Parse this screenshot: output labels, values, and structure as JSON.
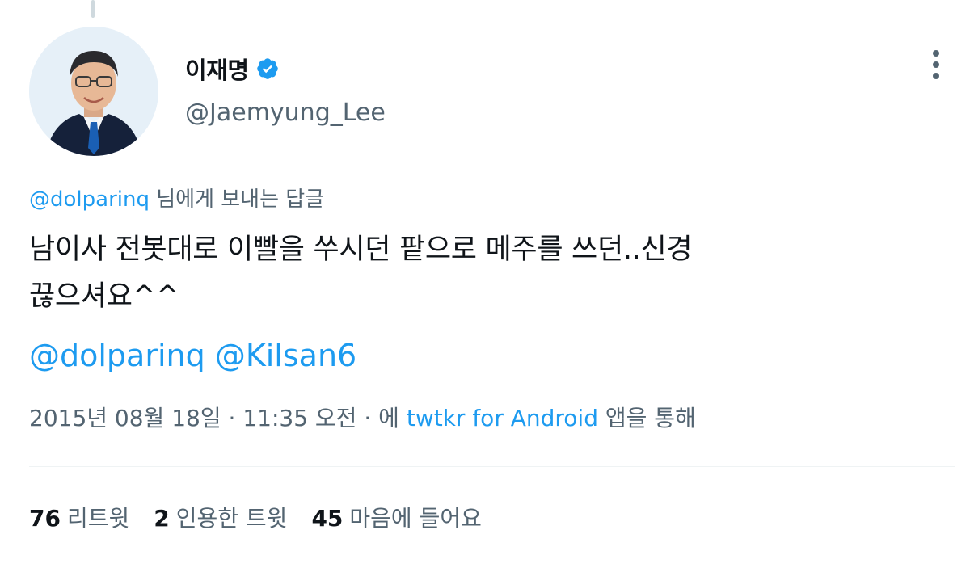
{
  "author": {
    "display_name": "이재명",
    "handle": "@Jaemyung_Lee",
    "verified": true
  },
  "reply_to": {
    "handle": "@dolparinq",
    "suffix": "님에게 보내는 답글"
  },
  "tweet": {
    "line1": "남이사 전봇대로 이빨을 쑤시던 팥으로 메주를 쓰던..신경",
    "line2": "끊으셔요^^",
    "mentions": [
      "@dolparinq",
      "@Kilsan6"
    ]
  },
  "meta": {
    "date": "2015년 08월 18일",
    "sep1": "·",
    "time": "11:35 오전",
    "sep2": "·",
    "via_prefix": "에",
    "source": "twtkr for Android",
    "via_suffix": "앱을 통해"
  },
  "stats": {
    "retweets": {
      "count": "76",
      "label": "리트윗"
    },
    "quotes": {
      "count": "2",
      "label": "인용한 트윗"
    },
    "likes": {
      "count": "45",
      "label": "마음에 들어요"
    }
  },
  "colors": {
    "link": "#1d9bf0",
    "secondary_text": "#536471",
    "primary_text": "#0f1419",
    "verified_badge": "#1d9bf0"
  },
  "icons": [
    "verified-badge-icon",
    "more-options-icon"
  ]
}
